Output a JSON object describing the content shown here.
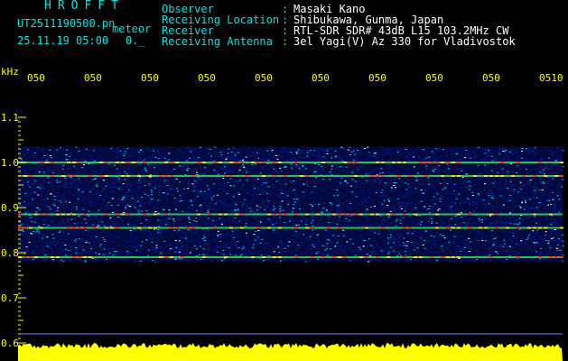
{
  "header": {
    "brand": "HROFFT",
    "filename": "UT2511190500.pn",
    "mode": "meteor",
    "datetime": "25.11.19 05:00",
    "suffix": "0._",
    "fields": [
      {
        "label": "Observer",
        "value": "Masaki Kano"
      },
      {
        "label": "Receiving Location",
        "value": "Shibukawa, Gunma, Japan"
      },
      {
        "label": "Receiver",
        "value": "RTL-SDR SDR# 43dB L15 103.2MHz CW"
      },
      {
        "label": "Receiving Antenna",
        "value": "3el Yagi(V) Az 330 for Vladivostok"
      }
    ],
    "separator": ":"
  },
  "axis": {
    "unit": "kHz",
    "time_labels": [
      "050",
      "050",
      "050",
      "050",
      "050",
      "050",
      "050",
      "050",
      "050",
      "0510"
    ],
    "freq_labels": [
      "1.1",
      "1.0",
      "0.9",
      "0.8",
      "0.7",
      "0.6"
    ]
  },
  "colors": {
    "header_text": "#00e5e5",
    "value_text": "#ffffff",
    "axis_text": "#ffff00",
    "background": "#000000",
    "noise_low": "#0a1aa0",
    "noise_mid": "#00c8ff",
    "noise_high": "#ff3020",
    "amplitude": "#ffff00"
  },
  "spectrogram": {
    "band_top_khz": 1.035,
    "band_bottom_khz": 0.78,
    "carrier_lines_khz": [
      1.0,
      0.97,
      0.885,
      0.855,
      0.79
    ]
  }
}
